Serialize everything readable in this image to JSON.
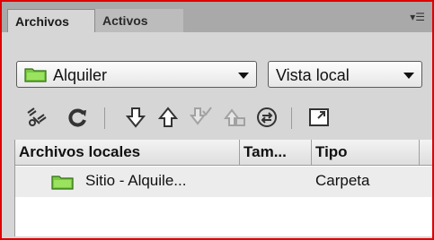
{
  "tabs": [
    "Archivos",
    "Activos"
  ],
  "panel_menu_icon": "panel-menu-icon",
  "site_select": {
    "value": "Alquiler",
    "icon": "folder-icon"
  },
  "view_select": {
    "value": "Vista local"
  },
  "toolbar": {
    "icons": [
      "connect-icon",
      "refresh-icon",
      "get-files-icon",
      "put-files-icon",
      "check-out-icon",
      "check-in-icon",
      "synchronize-icon",
      "expand-icon"
    ]
  },
  "file_list": {
    "columns": [
      "Archivos locales",
      "Tam...",
      "Tipo"
    ],
    "rows": [
      {
        "name": "Sitio - Alquile...",
        "size": "",
        "type": "Carpeta",
        "icon": "folder-icon"
      }
    ]
  },
  "colors": {
    "accent_border": "#e00000",
    "folder_green": "#7ac943"
  }
}
